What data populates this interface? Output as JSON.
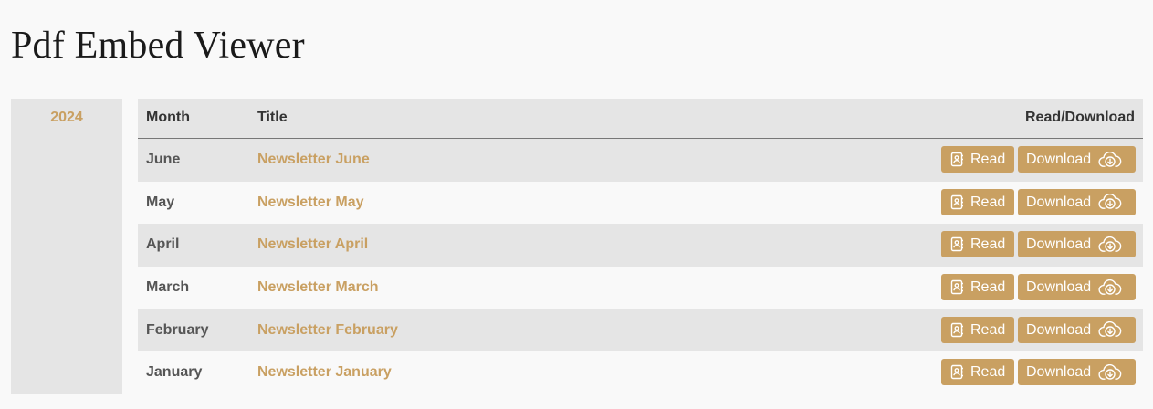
{
  "page": {
    "title": "Pdf Embed Viewer"
  },
  "years": [
    {
      "label": "2024",
      "active": true
    }
  ],
  "table": {
    "headers": {
      "month": "Month",
      "title": "Title",
      "action": "Read/Download"
    },
    "rows": [
      {
        "month": "June",
        "title": "Newsletter June",
        "read_label": "Read",
        "download_label": "Download"
      },
      {
        "month": "May",
        "title": "Newsletter May",
        "read_label": "Read",
        "download_label": "Download"
      },
      {
        "month": "April",
        "title": "Newsletter April",
        "read_label": "Read",
        "download_label": "Download"
      },
      {
        "month": "March",
        "title": "Newsletter March",
        "read_label": "Read",
        "download_label": "Download"
      },
      {
        "month": "February",
        "title": "Newsletter February",
        "read_label": "Read",
        "download_label": "Download"
      },
      {
        "month": "January",
        "title": "Newsletter January",
        "read_label": "Read",
        "download_label": "Download"
      }
    ]
  },
  "icons": {
    "read": "book-contact-icon",
    "download": "cloud-download-icon"
  },
  "colors": {
    "accent": "#c9a062",
    "background": "#f9f9f9",
    "panel": "#e5e5e5",
    "heading": "#1a1a1a",
    "text": "#555555"
  }
}
